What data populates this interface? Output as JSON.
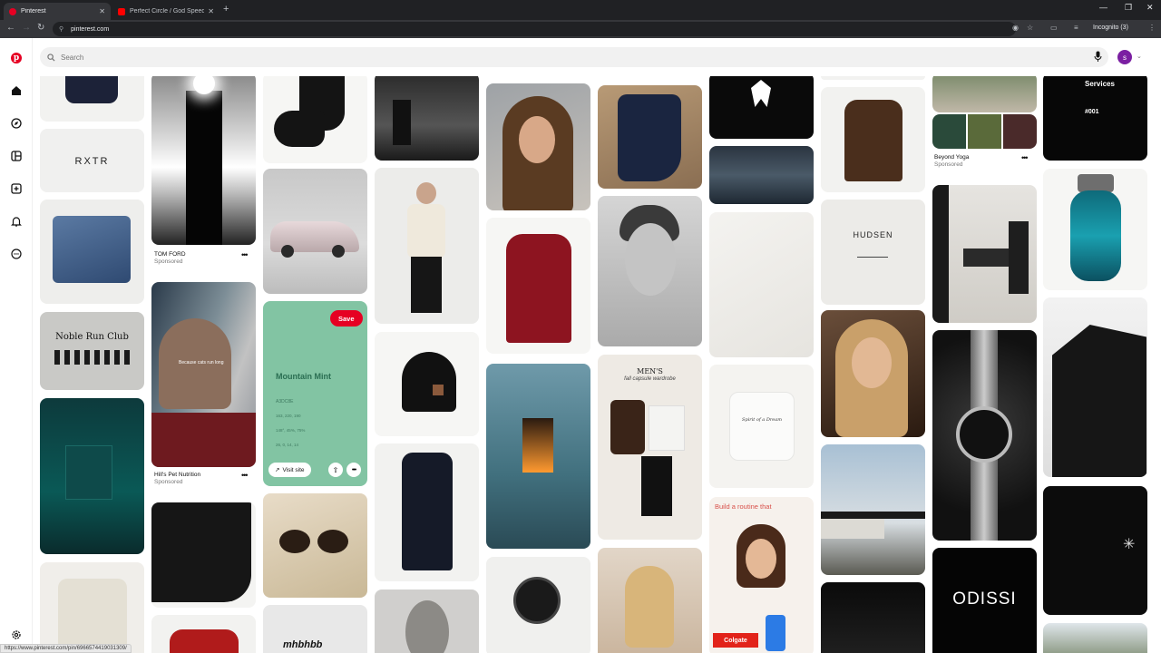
{
  "browser": {
    "tabs": [
      {
        "title": "Pinterest",
        "active": true
      },
      {
        "title": "Perfect Circle / God Speed - Yo",
        "active": false
      }
    ],
    "url": "pinterest.com",
    "profile": "Incognito (3)",
    "status_url": "https://www.pinterest.com/pin/6966574419031309/"
  },
  "search": {
    "placeholder": "Search"
  },
  "user": {
    "initial": "s"
  },
  "pins": {
    "rxtr": "RXTR",
    "tomford": {
      "name": "TOM FORD",
      "sponsored": "Sponsored"
    },
    "noble": "Noble Run Club",
    "hills": {
      "name": "Hill's Pet Nutrition",
      "sponsored": "Sponsored",
      "caption": "Because cats run long"
    },
    "mint": {
      "title": "Mountain Mint",
      "code": "A3DC8E",
      "rgb": "163, 220, 190",
      "hsl": "148°, 45%, 75%",
      "cmyk": "26, 0, 14, 14",
      "save": "Save",
      "visit": "Visit site"
    },
    "mens": {
      "title": "MEN'S",
      "subtitle": "fall capsule wardrobe"
    },
    "services": {
      "title": "Services",
      "number": "#001"
    },
    "hudsen": "HUDSEN",
    "beyond": {
      "name": "Beyond Yoga",
      "sponsored": "Sponsored"
    },
    "routine": "Build a routine that",
    "colgate": "Colgate",
    "odissi": "ODISSI",
    "spirit": "Spirit of a Dream",
    "mhbhbb": "mhbhbb"
  },
  "colors": {
    "brand": "#e60023",
    "mint": "#82c4a3"
  }
}
